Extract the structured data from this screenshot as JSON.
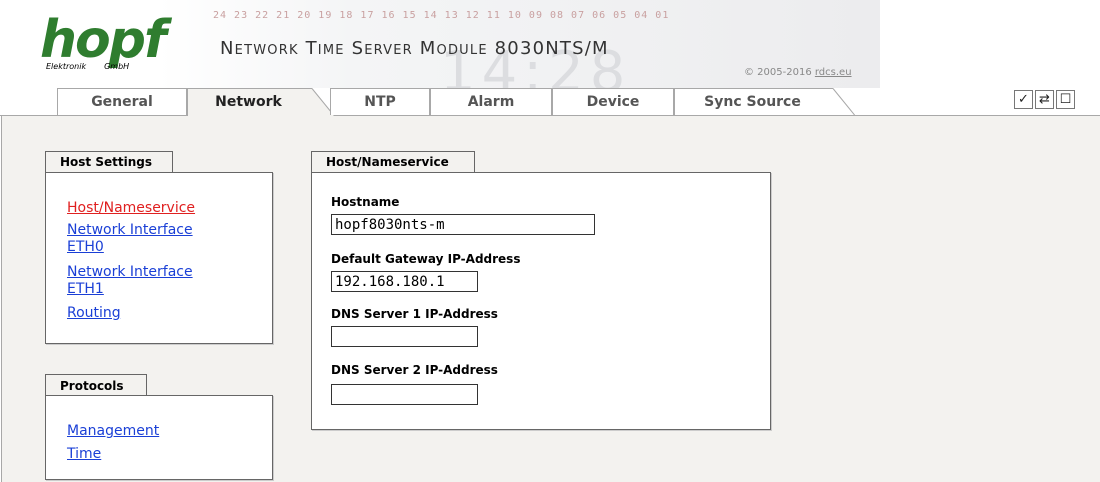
{
  "header": {
    "logo_text": "hopf",
    "logo_sub_left": "Elektronik",
    "logo_sub_right": "GmbH",
    "numbers": "24 23 22 21 20 19 18 17 16 15 14 13 12 11 10 09 08 07 06 05 04 01",
    "title": "Network Time Server Module 8030NTS/M",
    "copyright_prefix": "© 2005-2016",
    "copyright_link": "rdcs.eu"
  },
  "tabs": [
    {
      "label": "General",
      "active": false
    },
    {
      "label": "Network",
      "active": true
    },
    {
      "label": "NTP",
      "active": false
    },
    {
      "label": "Alarm",
      "active": false
    },
    {
      "label": "Device",
      "active": false
    },
    {
      "label": "Sync Source",
      "active": false
    }
  ],
  "toolbar": {
    "apply_icon": "check-icon",
    "apply_glyph": "✓",
    "reload_icon": "refresh-icon",
    "reload_glyph": "⇄",
    "save_icon": "save-icon",
    "save_glyph": "☐"
  },
  "host_settings": {
    "title": "Host Settings",
    "links": [
      {
        "label": "Host/Nameservice",
        "active": true
      },
      {
        "label": "Network Interface",
        "label2": "ETH0",
        "active": false
      },
      {
        "label": "Network Interface",
        "label2": "ETH1",
        "active": false
      },
      {
        "label": "Routing",
        "active": false
      }
    ]
  },
  "protocols": {
    "title": "Protocols",
    "links": [
      {
        "label": "Management"
      },
      {
        "label": "Time"
      }
    ]
  },
  "form": {
    "title": "Host/Nameservice",
    "hostname_label": "Hostname",
    "hostname_value": "hopf8030nts-m",
    "gateway_label": "Default Gateway IP-Address",
    "gateway_value": "192.168.180.1",
    "dns1_label": "DNS Server 1 IP-Address",
    "dns1_value": "",
    "dns2_label": "DNS Server 2 IP-Address",
    "dns2_value": ""
  },
  "colors": {
    "logo_green": "#2f7d2f",
    "link_blue": "#1a3fd6",
    "active_link_red": "#e02020",
    "content_bg": "#f3f2ef"
  }
}
